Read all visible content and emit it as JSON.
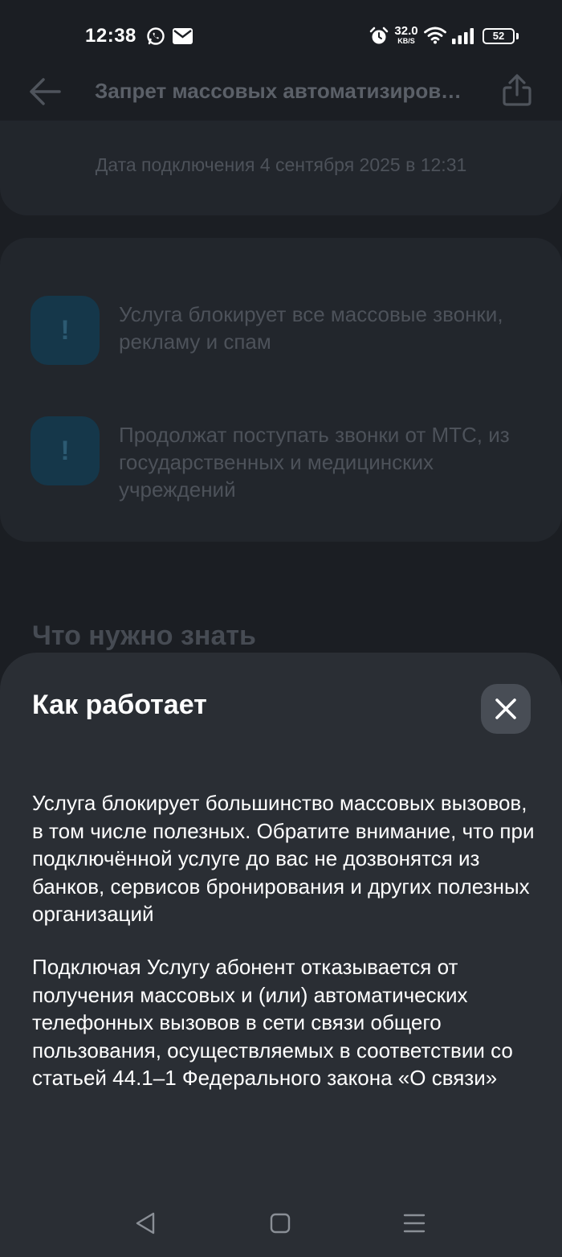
{
  "status_bar": {
    "time": "12:38",
    "net_speed_value": "32.0",
    "net_speed_unit": "KB/S",
    "battery_level": "52",
    "icons": [
      "whatsapp-icon",
      "mail-icon",
      "alarm-icon",
      "wifi-icon",
      "signal-icon",
      "battery-icon"
    ]
  },
  "header": {
    "title": "Запрет массовых автоматизированных вызовов",
    "back_icon": "arrow-left-icon",
    "share_icon": "share-icon"
  },
  "connection": {
    "date_text": "Дата подключения 4 сентября 2025 в 12:31"
  },
  "info_items": [
    {
      "icon": "exclamation-icon",
      "text": "Услуга блокирует все массовые звонки, рекламу и спам"
    },
    {
      "icon": "exclamation-icon",
      "text": "Продолжат поступать звонки от МТС, из государственных и медицинских учреждений"
    }
  ],
  "section": {
    "title": "Что нужно знать"
  },
  "sheet": {
    "title": "Как работает",
    "close_icon": "close-icon",
    "paragraphs": [
      "Услуга блокирует большинство массовых вызовов, в том числе полезных. Обратите внимание, что при подключённой услуге до вас не дозвонятся из банков, сервисов бронирования и других полезных организаций",
      "Подключая Услугу абонент отказывается от получения массовых и (или) автоматических телефонных вызовов в сети связи общего пользования, осуществляемых в соответствии со статьей 44.1–1 Федерального закона «О связи»"
    ]
  },
  "nav_bar": {
    "buttons": [
      "back-triangle-icon",
      "home-square-icon",
      "menu-lines-icon"
    ]
  },
  "colors": {
    "background": "#1b1e23",
    "sheet": "#2a2e34",
    "close_button": "#484d55",
    "accent_dimmed": "#15374a"
  }
}
